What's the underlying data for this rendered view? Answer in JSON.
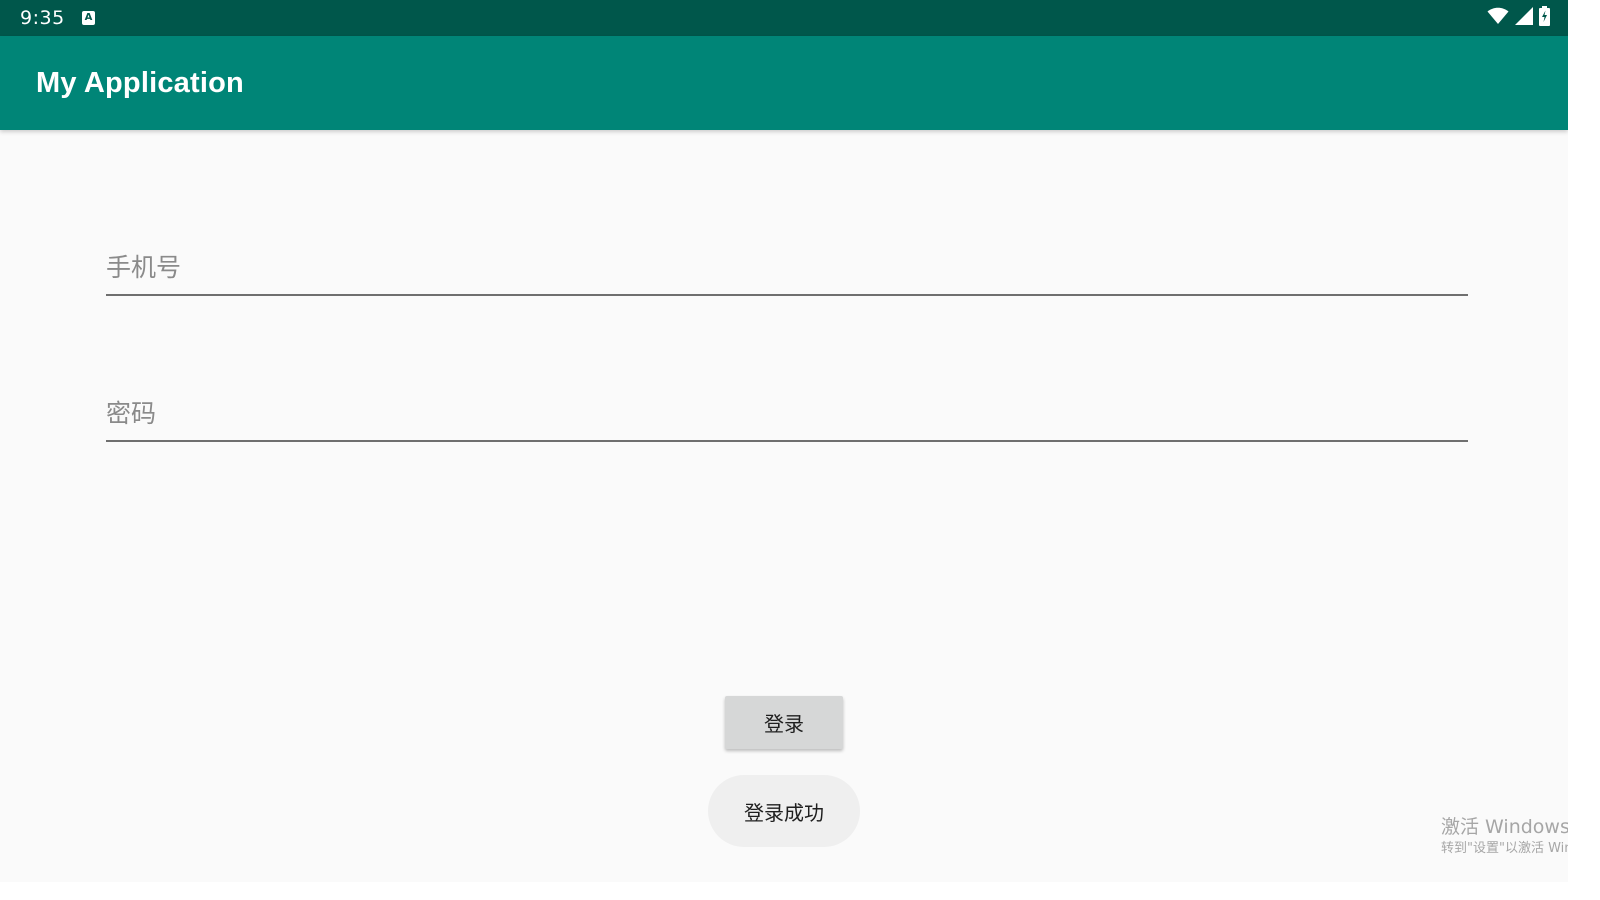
{
  "status_bar": {
    "time": "9:35",
    "notification_icon_letter": "A",
    "icons": [
      "notification-a-icon",
      "wifi-icon",
      "cell-signal-icon",
      "battery-charging-icon"
    ]
  },
  "app_bar": {
    "title": "My Application",
    "color": "#008577"
  },
  "form": {
    "phone_field": {
      "placeholder": "手机号",
      "value": ""
    },
    "password_field": {
      "placeholder": "密码",
      "value": ""
    },
    "login_button_label": "登录"
  },
  "toast": {
    "message": "登录成功"
  },
  "watermark": {
    "line1": "激活 Windows",
    "line2": "转到\"设置\"以激活 Windows。"
  },
  "colors": {
    "status_bar": "#00574b",
    "app_bar": "#008577",
    "background": "#fafafa",
    "button": "#d6d7d7"
  }
}
